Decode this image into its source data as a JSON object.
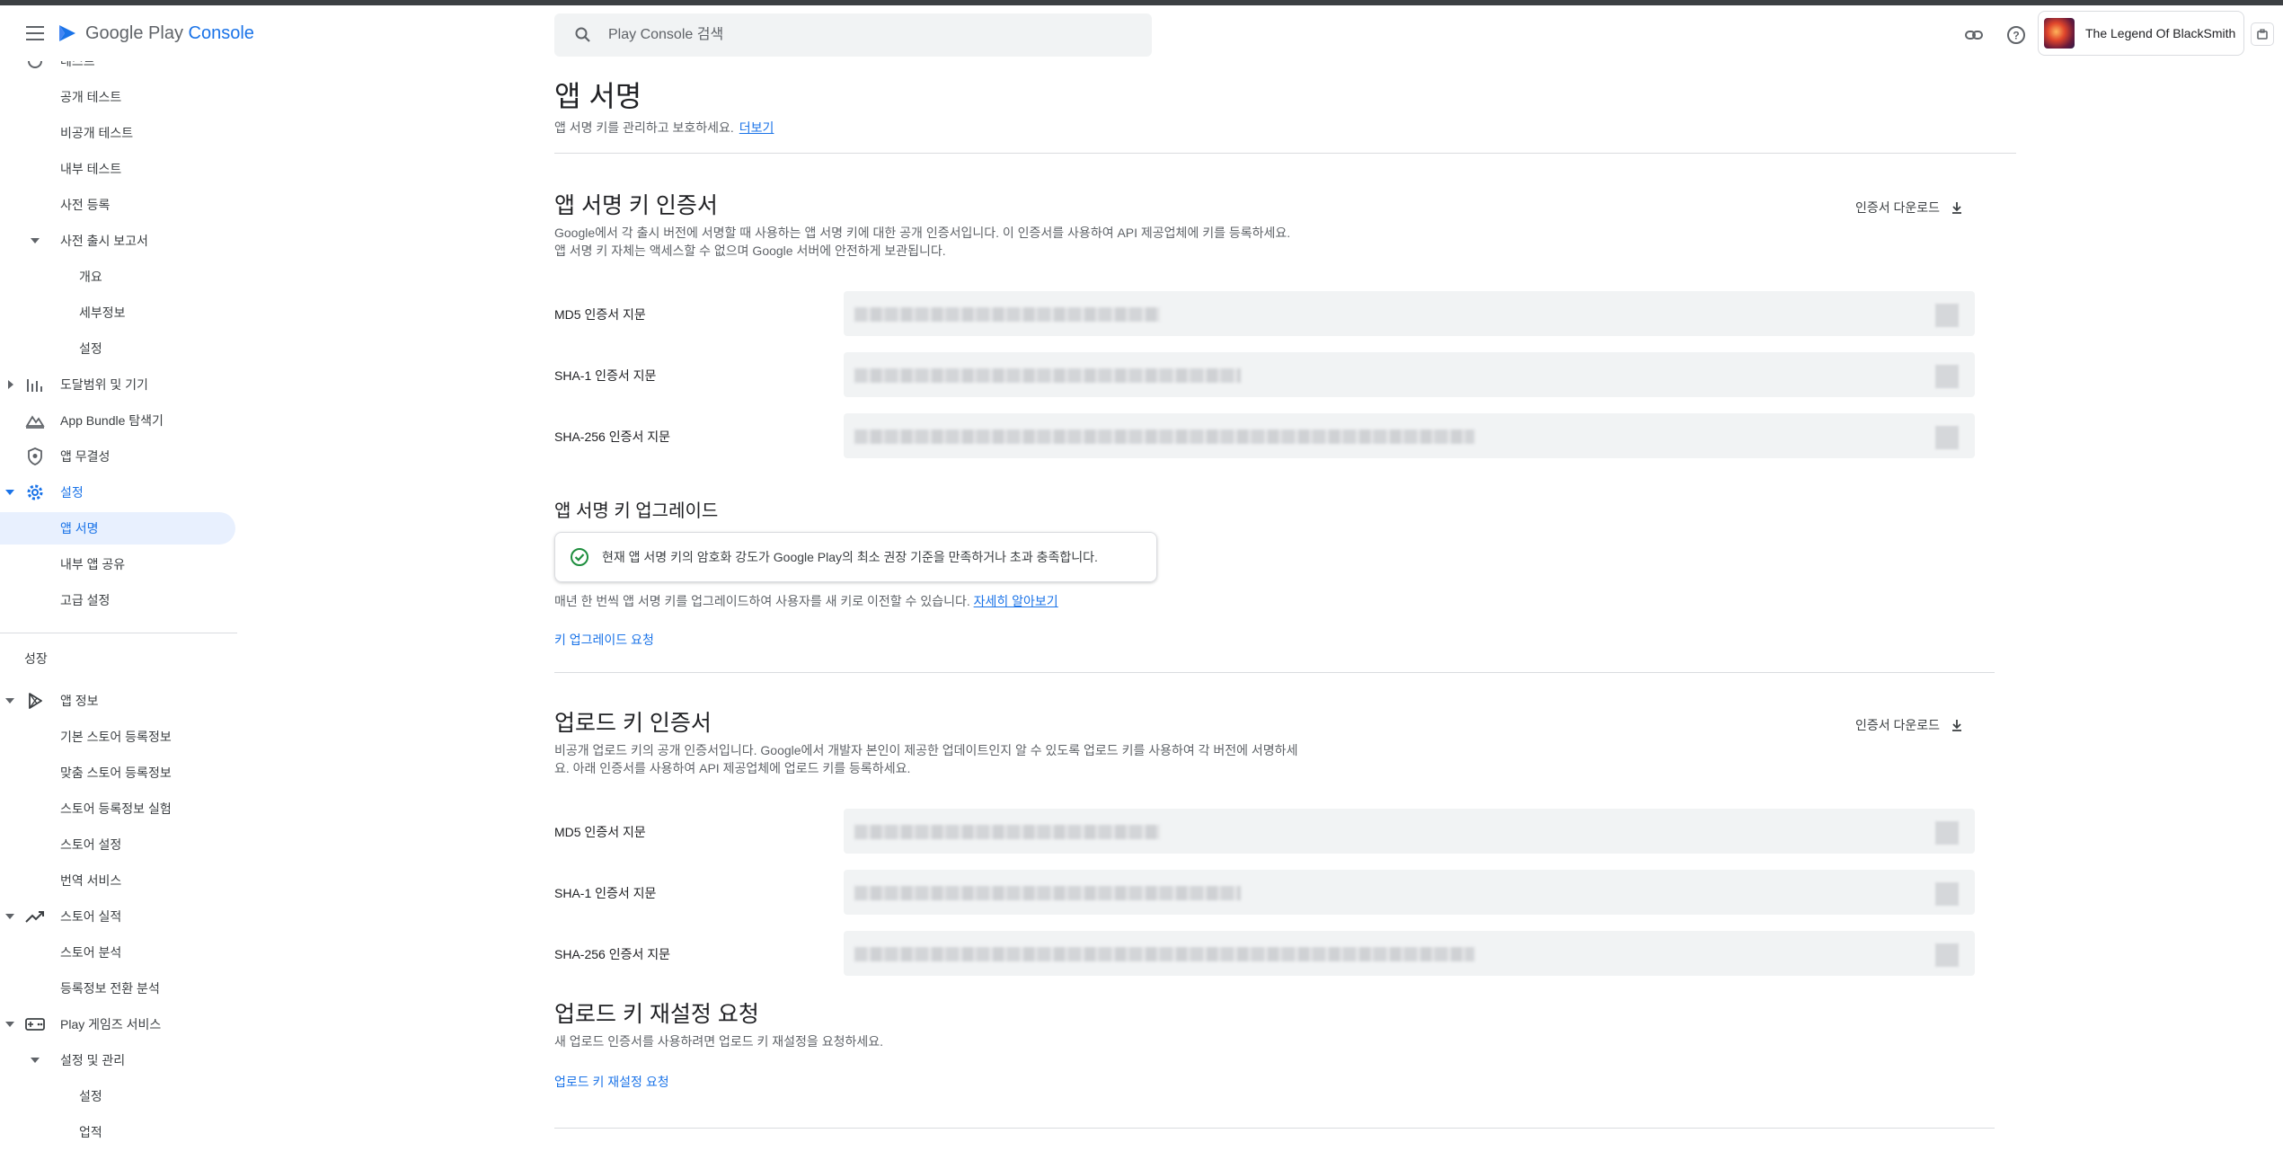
{
  "header": {
    "logo_prefix": "Google Play ",
    "logo_suffix": "Console",
    "search_placeholder": "Play Console 검색",
    "account_name": "The Legend Of BlackSmith"
  },
  "sidebar": {
    "top_partial": "테스트",
    "items": [
      {
        "label": "공개 테스트"
      },
      {
        "label": "비공개 테스트"
      },
      {
        "label": "내부 테스트"
      },
      {
        "label": "사전 등록"
      },
      {
        "label": "사전 출시 보고서"
      },
      {
        "label": "개요"
      },
      {
        "label": "세부정보"
      },
      {
        "label": "설정"
      },
      {
        "label": "도달범위 및 기기"
      },
      {
        "label": "App Bundle 탐색기"
      },
      {
        "label": "앱 무결성"
      },
      {
        "label": "설정"
      },
      {
        "label": "앱 서명"
      },
      {
        "label": "내부 앱 공유"
      },
      {
        "label": "고급 설정"
      }
    ],
    "section_title": "성장",
    "growth_items": [
      {
        "label": "앱 정보"
      },
      {
        "label": "기본 스토어 등록정보"
      },
      {
        "label": "맞춤 스토어 등록정보"
      },
      {
        "label": "스토어 등록정보 실험"
      },
      {
        "label": "스토어 설정"
      },
      {
        "label": "번역 서비스"
      },
      {
        "label": "스토어 실적"
      },
      {
        "label": "스토어 분석"
      },
      {
        "label": "등록정보 전환 분석"
      },
      {
        "label": "Play 게임즈 서비스"
      },
      {
        "label": "설정 및 관리"
      },
      {
        "label": "설정"
      },
      {
        "label": "업적"
      }
    ]
  },
  "page": {
    "title": "앱 서명",
    "subtitle": "앱 서명 키를 관리하고 보호하세요.",
    "subtitle_link": "더보기"
  },
  "app_signing_cert": {
    "title": "앱 서명 키 인증서",
    "desc_line1": "Google에서 각 출시 버전에 서명할 때 사용하는 앱 서명 키에 대한 공개 인증서입니다. 이 인증서를 사용하여 API 제공업체에 키를 등록하세요.",
    "desc_line2": "앱 서명 키 자체는 액세스할 수 없으며 Google 서버에 안전하게 보관됩니다.",
    "download_label": "인증서 다운로드",
    "md5_label": "MD5 인증서 지문",
    "sha1_label": "SHA-1 인증서 지문",
    "sha256_label": "SHA-256 인증서 지문"
  },
  "key_upgrade": {
    "title": "앱 서명 키 업그레이드",
    "notice": "현재 앱 서명 키의 암호화 강도가 Google Play의 최소 권장 기준을 만족하거나 초과 충족합니다.",
    "desc": "매년 한 번씩 앱 서명 키를 업그레이드하여 사용자를 새 키로 이전할 수 있습니다.",
    "desc_link": "자세히 알아보기",
    "request_link": "키 업그레이드 요청"
  },
  "upload_cert": {
    "title": "업로드 키 인증서",
    "desc_line1": "비공개 업로드 키의 공개 인증서입니다. Google에서 개발자 본인이 제공한 업데이트인지 알 수 있도록 업로드 키를 사용하여 각 버전에 서명하세",
    "desc_line2": "요. 아래 인증서를 사용하여 API 제공업체에 업로드 키를 등록하세요.",
    "download_label": "인증서 다운로드",
    "md5_label": "MD5 인증서 지문",
    "sha1_label": "SHA-1 인증서 지문",
    "sha256_label": "SHA-256 인증서 지문"
  },
  "upload_reset": {
    "title": "업로드 키 재설정 요청",
    "desc": "새 업로드 인증서를 사용하려면 업로드 키 재설정을 요청하세요.",
    "link": "업로드 키 재설정 요청"
  },
  "colors": {
    "accent": "#1a73e8",
    "active_bg": "#e8f0fe",
    "success": "#1e8e3e",
    "field_bg": "#f1f3f4"
  }
}
